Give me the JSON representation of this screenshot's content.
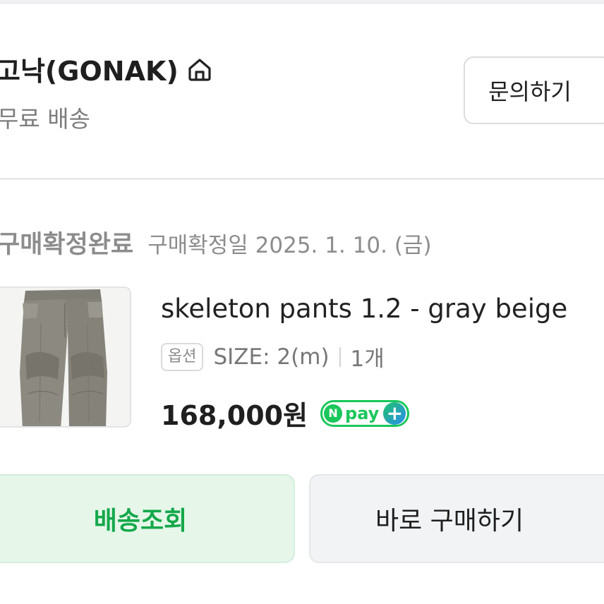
{
  "seller": {
    "name": "고낙(GONAK)",
    "home_icon": "home-icon",
    "shipping_note": "무료 배송",
    "inquiry_label": "문의하기"
  },
  "order": {
    "status": "구매확정완료",
    "confirm_date": "구매확정일 2025. 1. 10. (금)",
    "product": {
      "thumbnail": "gray-cargo-pants-photo",
      "name": "skeleton pants 1.2 - gray beige",
      "option_tag": "옵션",
      "option_value": "SIZE: 2(m)",
      "quantity": "1개",
      "price": "168,000원",
      "npay": {
        "n": "N",
        "label": "pay",
        "plus": "+"
      }
    }
  },
  "actions": {
    "track_label": "배송조회",
    "buy_again_label": "바로 구매하기"
  },
  "colors": {
    "accent_green": "#14a84a",
    "track_bg": "#e6f7ea",
    "muted_text": "#8c8c8c"
  }
}
